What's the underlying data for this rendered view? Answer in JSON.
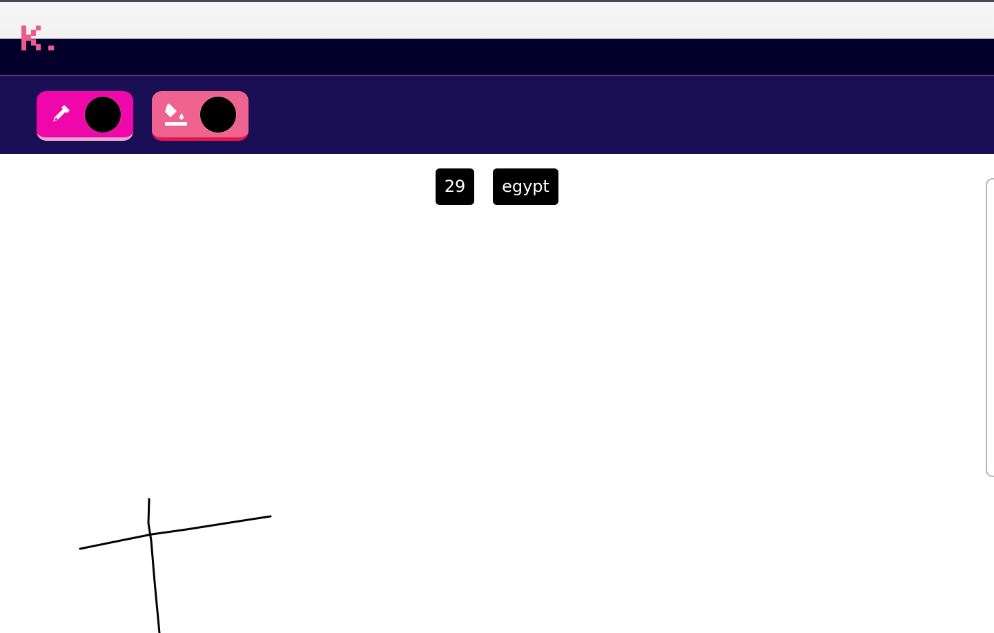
{
  "app": {
    "logo_text": "K.",
    "brand_color": "#ec5b8c"
  },
  "toolbar": {
    "color_picker": {
      "icon": "eyedropper-icon",
      "color": "#000000",
      "button_color": "#f007a9"
    },
    "fill_tool": {
      "icon": "paint-bucket-icon",
      "color": "#000000",
      "button_color": "#ee6390"
    }
  },
  "game": {
    "round": "29",
    "word": "egypt"
  },
  "canvas": {
    "stroke_color": "#000000"
  }
}
